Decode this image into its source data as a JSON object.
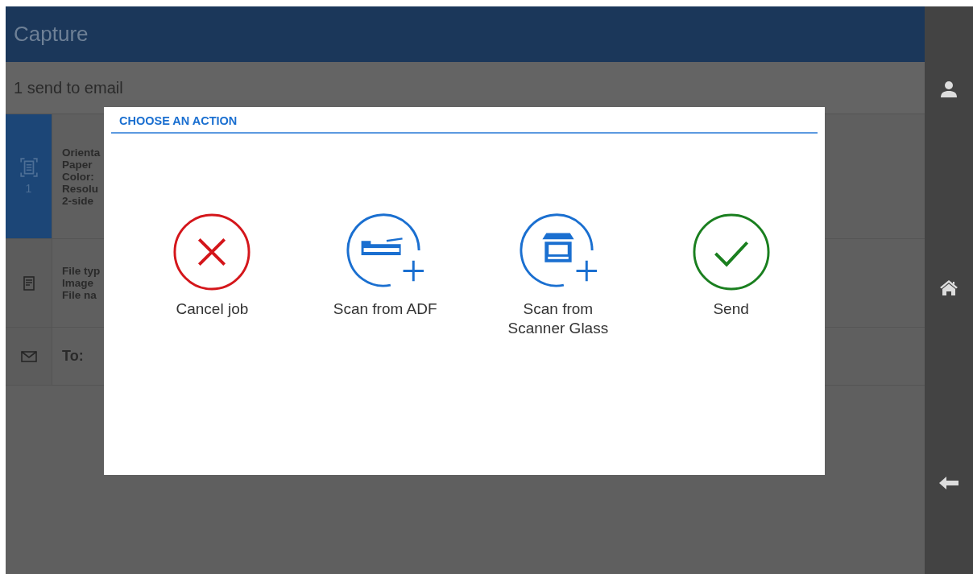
{
  "header": {
    "title": "Capture"
  },
  "subheader": {
    "text": "1 send to email"
  },
  "rows": [
    {
      "kind": "scan",
      "selected": true,
      "count": "1",
      "lines": [
        "Orienta",
        "Paper",
        "Color:",
        "Resolu",
        "2-side"
      ]
    },
    {
      "kind": "file",
      "selected": false,
      "lines": [
        "File typ",
        "Image",
        "File na"
      ]
    },
    {
      "kind": "email",
      "selected": false,
      "lines": [
        "To:"
      ]
    }
  ],
  "dialog": {
    "title": "CHOOSE AN ACTION",
    "actions": [
      {
        "kind": "cancel",
        "label": "Cancel job"
      },
      {
        "kind": "adf",
        "label": "Scan from ADF"
      },
      {
        "kind": "glass",
        "label": "Scan from Scanner Glass"
      },
      {
        "kind": "send",
        "label": "Send"
      }
    ]
  },
  "sidebar": {
    "items": [
      {
        "kind": "user"
      },
      {
        "kind": "home"
      },
      {
        "kind": "back"
      }
    ]
  }
}
